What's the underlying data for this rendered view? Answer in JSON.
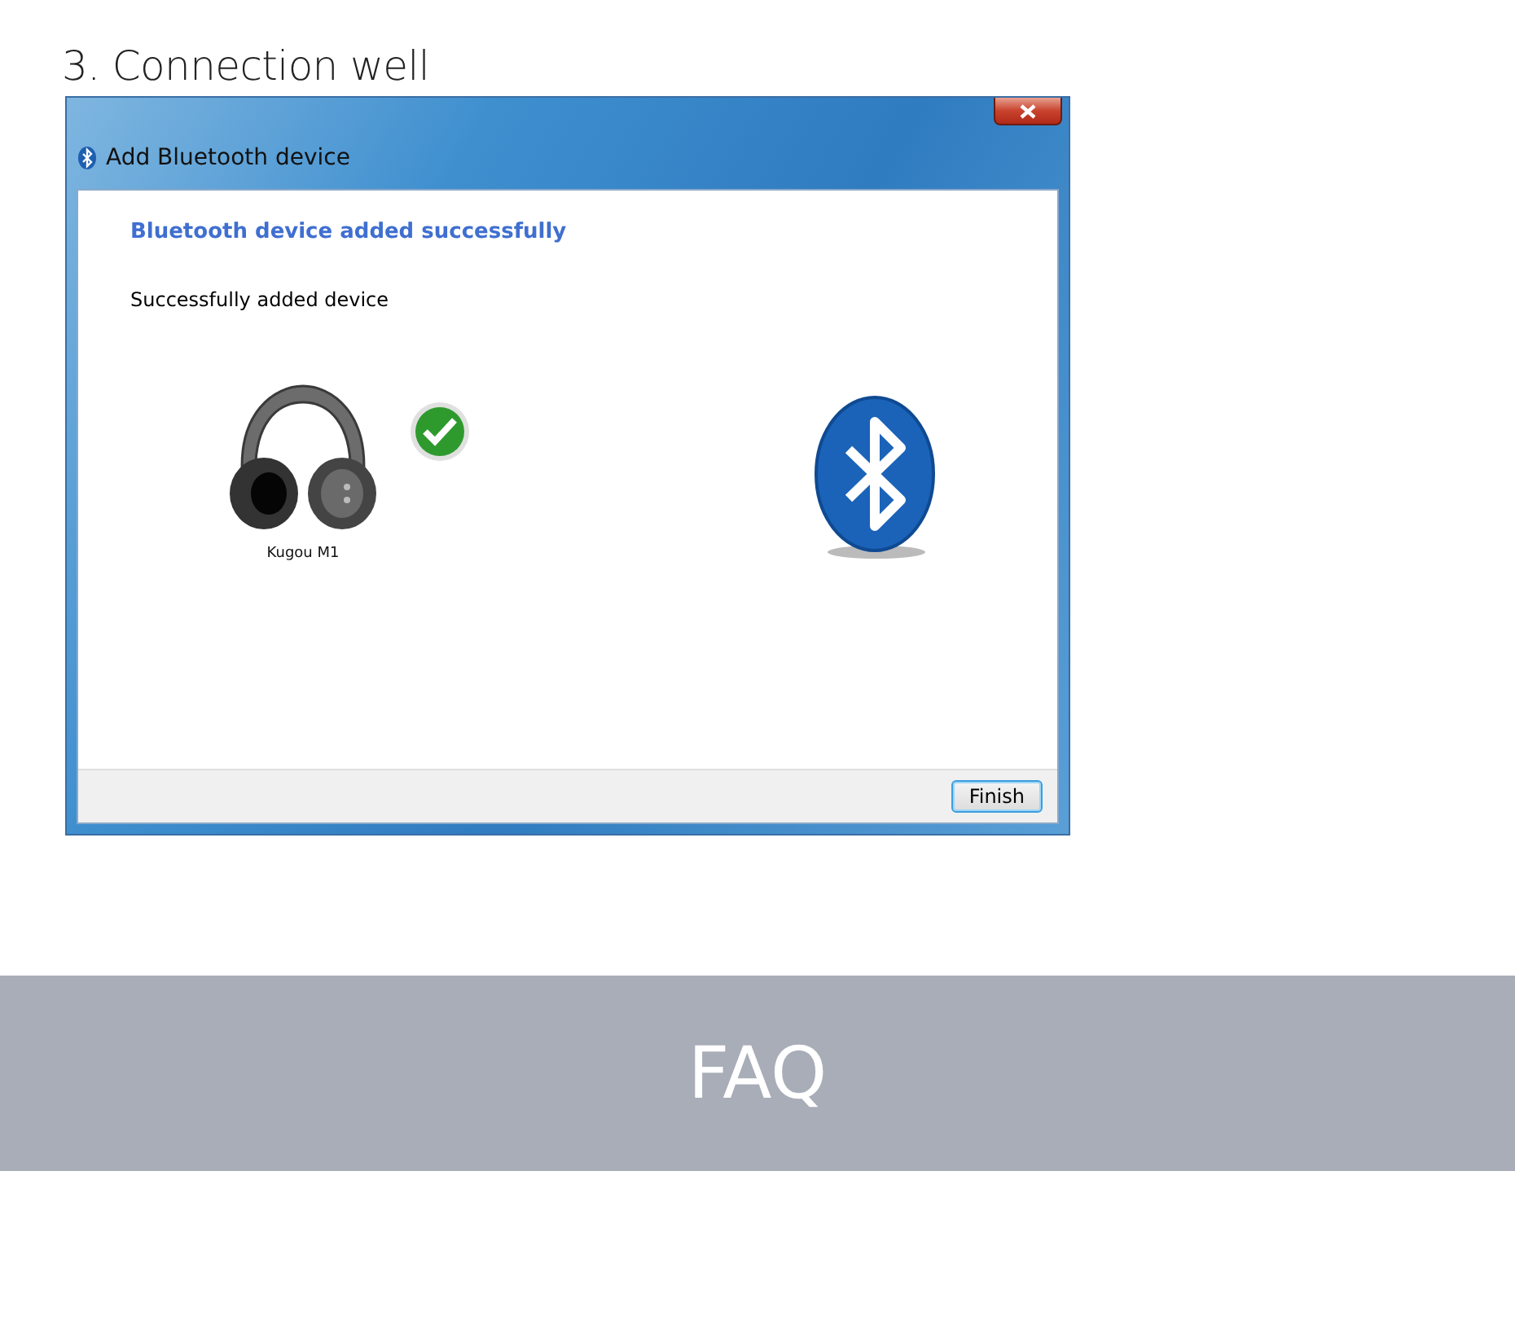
{
  "heading": "3. Connection well",
  "dialog": {
    "title": "Add Bluetooth device",
    "status_heading": "Bluetooth device added successfully",
    "message": "Successfully added device",
    "device": {
      "name": "Kugou M1",
      "connected": true
    },
    "buttons": [
      {
        "label": "Finish",
        "default": true
      }
    ]
  },
  "banner": {
    "title": "FAQ"
  }
}
